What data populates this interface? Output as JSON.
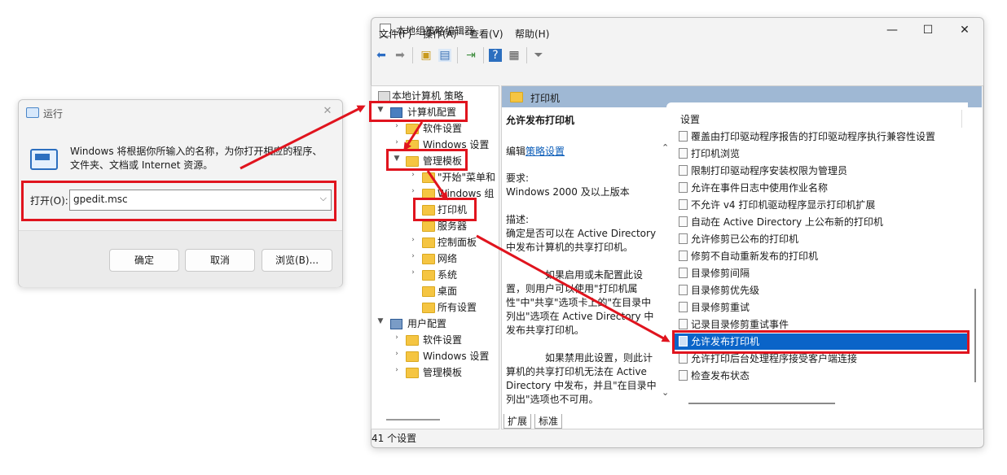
{
  "run_dialog": {
    "title": "运行",
    "description": "Windows 将根据你所输入的名称，为你打开相应的程序、文件夹、文档或 Internet 资源。",
    "open_label": "打开(O):",
    "input_value": "gpedit.msc",
    "ok": "确定",
    "cancel": "取消",
    "browse": "浏览(B)..."
  },
  "gpedit": {
    "title": "本地组策略编辑器",
    "menu": [
      "文件(F)",
      "操作(A)",
      "查看(V)",
      "帮助(H)"
    ],
    "tree": {
      "root": "本地计算机 策略",
      "computer_config": "计算机配置",
      "software_settings": "软件设置",
      "windows_settings": "Windows 设置",
      "admin_templates": "管理模板",
      "start_menu": "\"开始\"菜单和",
      "windows_components": "Windows 组",
      "printers": "打印机",
      "server": "服务器",
      "control_panel": "控制面板",
      "network": "网络",
      "system": "系统",
      "desktop": "桌面",
      "all_settings": "所有设置",
      "user_config": "用户配置",
      "user_software": "软件设置",
      "user_windows": "Windows 设置",
      "user_admin": "管理模板"
    },
    "pane_header": "打印机",
    "desc": {
      "title": "允许发布打印机",
      "edit_prefix": "编辑",
      "edit_link": "策略设置",
      "req_label": "要求:",
      "req_value": "Windows 2000 及以上版本",
      "desc_label": "描述:",
      "desc_text": "确定是否可以在 Active Directory 中发布计算机的共享打印机。",
      "para1": "如果启用或未配置此设置，则用户可以使用\"打印机属性\"中\"共享\"选项卡上的\"在目录中列出\"选项在 Active Directory 中发布共享打印机。",
      "para2": "如果禁用此设置，则此计算机的共享打印机无法在 Active Directory 中发布，并且\"在目录中列出\"选项也不可用。"
    },
    "settings_header": "设置",
    "settings": [
      "覆盖由打印驱动程序报告的打印驱动程序执行兼容性设置",
      "打印机浏览",
      "限制打印驱动程序安装权限为管理员",
      "允许在事件日志中使用作业名称",
      "不允许 v4 打印机驱动程序显示打印机扩展",
      "自动在 Active Directory 上公布新的打印机",
      "允许修剪已公布的打印机",
      "修剪不自动重新发布的打印机",
      "目录修剪间隔",
      "目录修剪优先级",
      "目录修剪重试",
      "记录目录修剪重试事件",
      "允许发布打印机",
      "允许打印后台处理程序接受客户端连接",
      "检查发布状态"
    ],
    "selected_setting": "允许发布打印机",
    "tabs": [
      "扩展",
      "标准"
    ],
    "status": "41 个设置"
  },
  "colors": {
    "highlight": "#e0141e",
    "selection": "#0a64c8",
    "pane_header": "#9fb8d4"
  }
}
